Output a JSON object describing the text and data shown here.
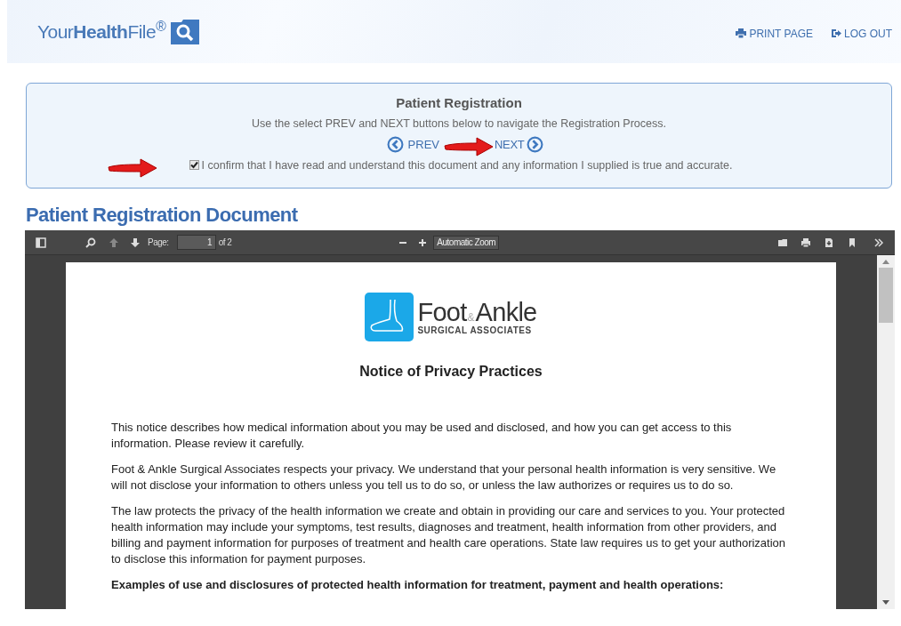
{
  "header": {
    "logo": "Your**Health**File$^{®}$",
    "links": [
      {
        "kind": "print",
        "label": "PRINT PAGE"
      },
      {
        "kind": "logout",
        "label": "LOG OUT"
      }
    ]
  },
  "registration_panel": {
    "title": "Patient Registration",
    "instructions": "Use the select PREV and NEXT buttons below to navigate the Registration Process.",
    "prev": "PREV",
    "next": "NEXT",
    "confirm": {
      "label": "I confirm that I have read and understand this document and any information I supplied is true and accurate.",
      "checked": true
    }
  },
  "document_heading": "Patient Registration Document",
  "viewer": {
    "toolbar": {
      "page_label": "Page:",
      "page": "1",
      "page_count": "of 2",
      "zoom": "Automatic Zoom"
    },
    "document": {
      "logo": {
        "word_1": "Foot",
        "ampersand": "&",
        "word_2": "Ankle",
        "subtitle": "SURGICAL ASSOCIATES"
      },
      "title": "Notice of Privacy Practices",
      "paragraphs": [
        {
          "kind": "body",
          "text": "This notice describes how medical information about you may be used and disclosed, and how you can get access to this information. Please review it carefully."
        },
        {
          "kind": "body",
          "text": "Foot & Ankle Surgical Associates respects your privacy. We understand that your personal health information is very sensitive. We will not disclose your information to others unless you tell us to do so, or unless the law authorizes or requires us to do so."
        },
        {
          "kind": "body",
          "text": "The law protects the privacy of the health information we create and obtain in providing our care and services to you. Your protected health information may include your symptoms, test results, diagnoses and treatment, health information from other providers, and billing and payment information for purposes of treatment and health care operations. State law requires us to get your authorization to disclose this information for payment purposes."
        },
        {
          "kind": "heading",
          "text": "Examples of use and disclosures of protected health information for treatment, payment and health operations:"
        }
      ]
    }
  }
}
